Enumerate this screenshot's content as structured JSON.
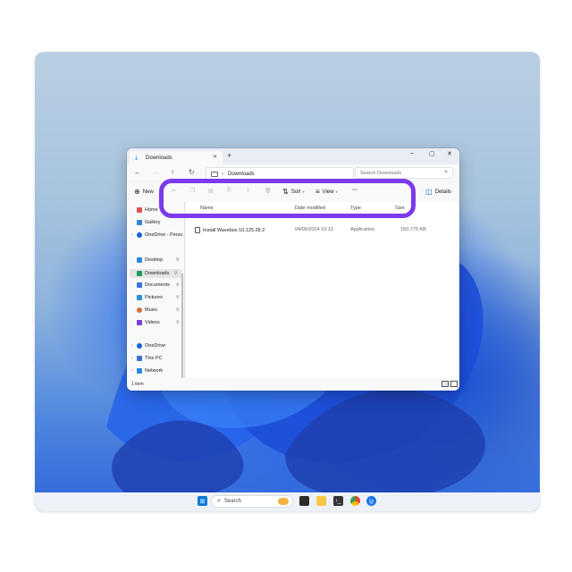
{
  "window": {
    "tab_title": "Downloads",
    "tab_close": "✕",
    "new_tab": "+",
    "controls": [
      "–",
      "▢",
      "✕"
    ]
  },
  "address": {
    "nav": [
      "←",
      "→",
      "↑",
      "↻"
    ],
    "breadcrumb_sep": "›",
    "path": "Downloads",
    "search_placeholder": "Search Downloads"
  },
  "toolbar": {
    "new_label": "New",
    "sort_label": "Sort",
    "view_label": "View",
    "more_label": "···",
    "details_label": "Details"
  },
  "sidebar": {
    "items": [
      {
        "label": "Home",
        "color": "#d9534f"
      },
      {
        "label": "Gallery",
        "color": "#2b88d8"
      },
      {
        "label": "OneDrive - Perso",
        "color": "#0a64d6"
      },
      {
        "label": "Desktop",
        "color": "#2b88d8"
      },
      {
        "label": "Downloads",
        "color": "#1a9c5a"
      },
      {
        "label": "Documents",
        "color": "#3b6fd1"
      },
      {
        "label": "Pictures",
        "color": "#2b8fd8"
      },
      {
        "label": "Music",
        "color": "#e06a3a"
      },
      {
        "label": "Videos",
        "color": "#7b3fd1"
      },
      {
        "label": "OneDrive",
        "color": "#0a64d6"
      },
      {
        "label": "This PC",
        "color": "#3b6fd1"
      },
      {
        "label": "Network",
        "color": "#2b88d8"
      }
    ]
  },
  "columns": {
    "name": "Name",
    "date": "Date modified",
    "type": "Type",
    "size": "Size"
  },
  "files": [
    {
      "name": "Install Wavebox 10.125.28.2",
      "date": "04/06/2024 10:13",
      "type": "Application",
      "size": "150,775 KB"
    }
  ],
  "status": {
    "count": "1 item"
  },
  "taskbar": {
    "search_label": "Search"
  },
  "colors": {
    "highlight": "#7c3aed"
  }
}
